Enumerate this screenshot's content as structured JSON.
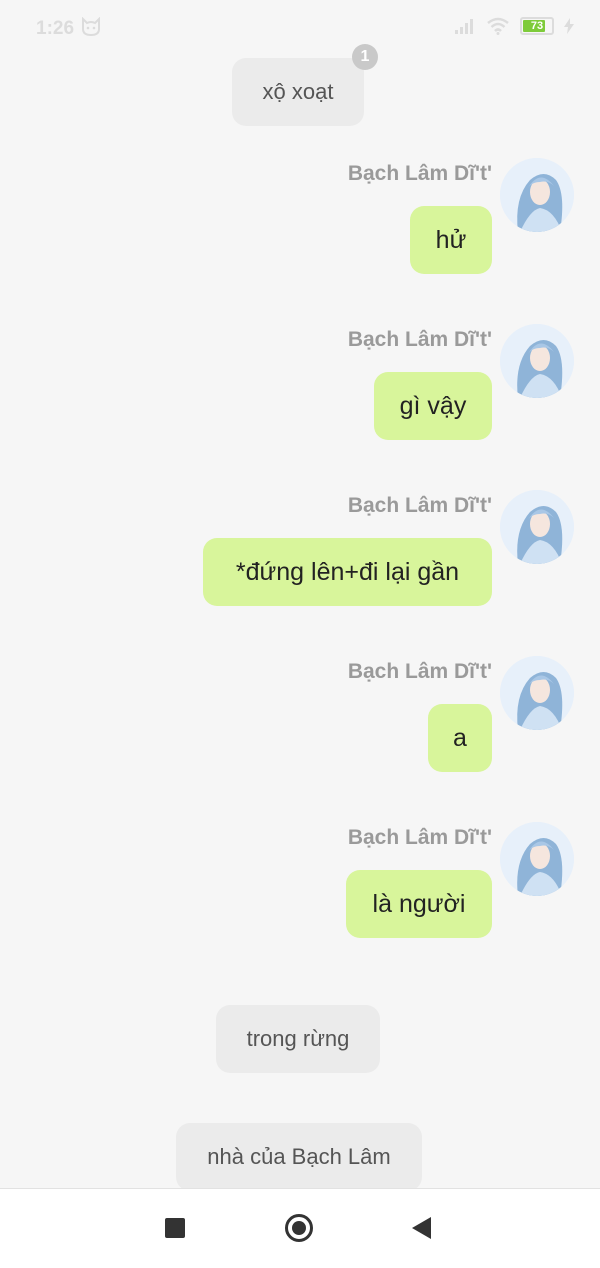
{
  "status": {
    "time": "1:26",
    "battery": "73"
  },
  "system_messages": [
    {
      "text": "xộ xoạt",
      "badge": "1"
    },
    {
      "text": "trong rừng"
    },
    {
      "text": "nhà của Bạch Lâm"
    }
  ],
  "messages": [
    {
      "sender": "Bạch Lâm Dĩ't'",
      "text": "hử"
    },
    {
      "sender": "Bạch Lâm Dĩ't'",
      "text": "gì vậy"
    },
    {
      "sender": "Bạch Lâm Dĩ't'",
      "text": "*đứng lên+đi lại gần"
    },
    {
      "sender": "Bạch Lâm Dĩ't'",
      "text": "a"
    },
    {
      "sender": "Bạch Lâm Dĩ't'",
      "text": "là người"
    }
  ],
  "colors": {
    "bubble": "#d8f59b",
    "system_bubble": "#ebebeb",
    "background": "#f6f6f6"
  },
  "nav": {
    "icons": [
      "recents-square-icon",
      "home-circle-icon",
      "back-triangle-icon"
    ]
  }
}
